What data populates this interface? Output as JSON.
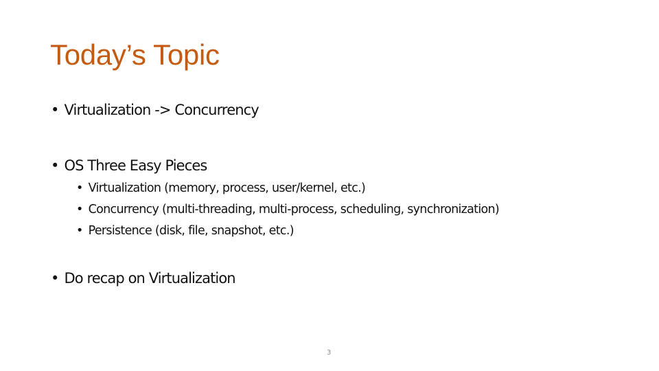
{
  "slide": {
    "title": "Today’s Topic",
    "bullet_glyph": "•",
    "bullets": [
      {
        "text": "Virtualization -> Concurrency"
      },
      {
        "text": "OS Three Easy Pieces",
        "sub": [
          "Virtualization (memory, process, user/kernel, etc.)",
          "Concurrency (multi-threading, multi-process, scheduling, synchronization)",
          "Persistence (disk, file, snapshot, etc.)"
        ]
      },
      {
        "text": "Do recap on Virtualization"
      }
    ],
    "page_number": "3",
    "colors": {
      "title": "#C55A11",
      "text": "#111111"
    }
  }
}
